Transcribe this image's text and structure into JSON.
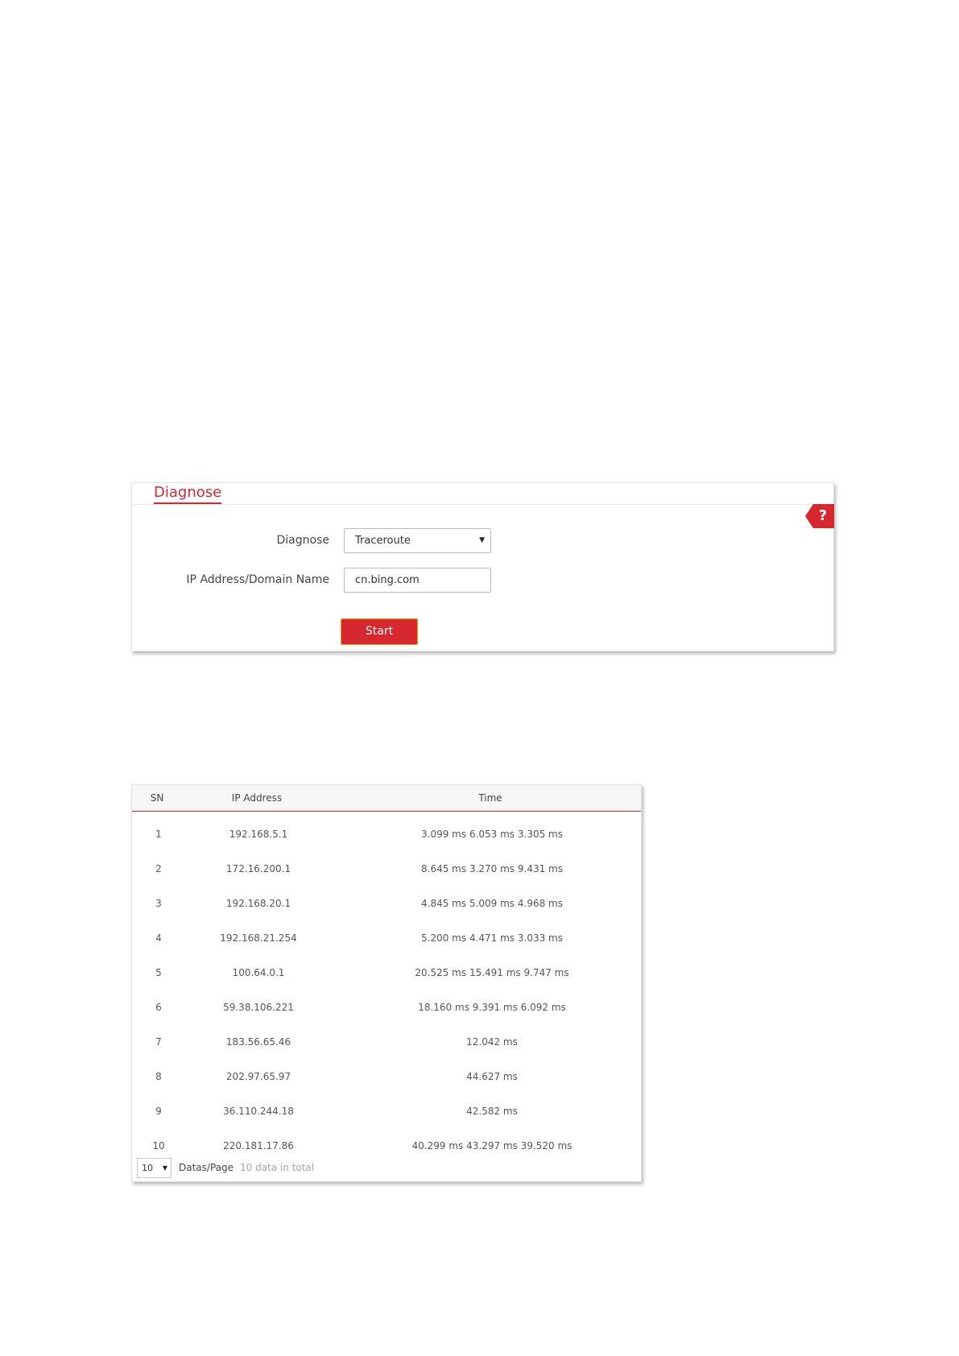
{
  "diagnose": {
    "title": "Diagnose",
    "help_icon": "?",
    "type_label": "Diagnose",
    "type_value": "Traceroute",
    "address_label": "IP Address/Domain Name",
    "address_value": "cn.bing.com",
    "start_label": "Start",
    "colors": {
      "accent": "#d7282f",
      "button_border": "#f0a000"
    }
  },
  "results": {
    "headers": {
      "sn": "SN",
      "ip": "IP Address",
      "time": "Time"
    },
    "rows": [
      {
        "sn": "1",
        "ip": "192.168.5.1",
        "time": "3.099 ms 6.053 ms 3.305 ms"
      },
      {
        "sn": "2",
        "ip": "172.16.200.1",
        "time": "8.645 ms 3.270 ms 9.431 ms"
      },
      {
        "sn": "3",
        "ip": "192.168.20.1",
        "time": "4.845 ms 5.009 ms 4.968 ms"
      },
      {
        "sn": "4",
        "ip": "192.168.21.254",
        "time": "5.200 ms 4.471 ms 3.033 ms"
      },
      {
        "sn": "5",
        "ip": "100.64.0.1",
        "time": "20.525 ms 15.491 ms 9.747 ms"
      },
      {
        "sn": "6",
        "ip": "59.38.106.221",
        "time": "18.160 ms 9.391 ms 6.092 ms"
      },
      {
        "sn": "7",
        "ip": "183.56.65.46",
        "time": "12.042 ms"
      },
      {
        "sn": "8",
        "ip": "202.97.65.97",
        "time": "44.627 ms"
      },
      {
        "sn": "9",
        "ip": "36.110.244.18",
        "time": "42.582 ms"
      },
      {
        "sn": "10",
        "ip": "220.181.17.86",
        "time": "40.299 ms 43.297 ms 39.520 ms"
      }
    ],
    "pagination": {
      "page_size": "10",
      "per_page_label": "Datas/Page",
      "total_label": "10 data in total"
    }
  }
}
